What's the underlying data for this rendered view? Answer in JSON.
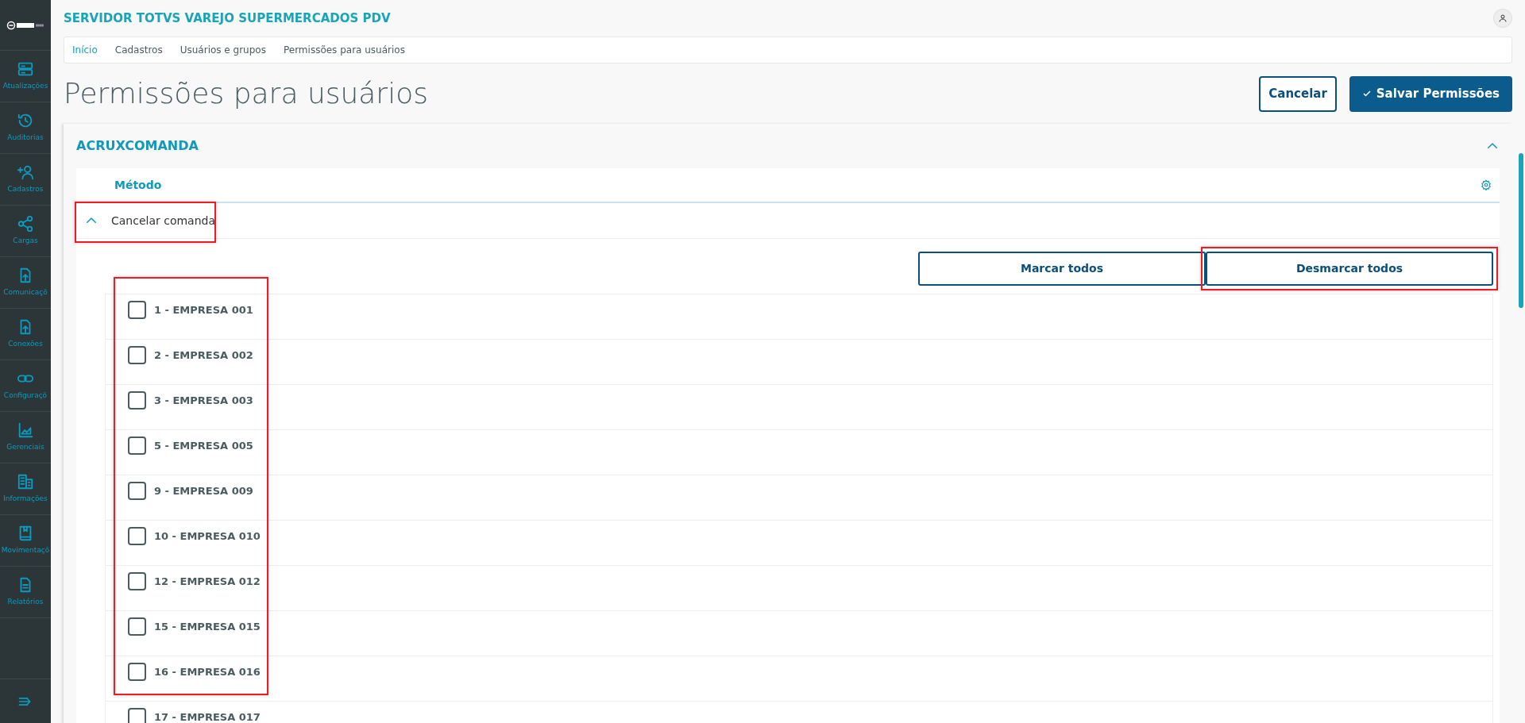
{
  "app": {
    "title": "SERVIDOR TOTVS VAREJO SUPERMERCADOS PDV"
  },
  "sidebar": {
    "items": [
      {
        "label": "Atualizações"
      },
      {
        "label": "Auditorias"
      },
      {
        "label": "Cadastros"
      },
      {
        "label": "Cargas"
      },
      {
        "label": "Comunicaçõ"
      },
      {
        "label": "Conexões"
      },
      {
        "label": "Configuraçõ"
      },
      {
        "label": "Gerenciais"
      },
      {
        "label": "Informações"
      },
      {
        "label": "Movimentaçõ"
      },
      {
        "label": "Relatórios"
      }
    ]
  },
  "breadcrumb": [
    {
      "label": "Início",
      "link": true
    },
    {
      "label": "Cadastros",
      "link": false
    },
    {
      "label": "Usuários e grupos",
      "link": false
    },
    {
      "label": "Permissões para usuários",
      "link": false
    }
  ],
  "page_title": "Permissões para usuários",
  "actions": [
    {
      "label": "Cancelar",
      "kind": "outline"
    },
    {
      "label": "Salvar Permissões",
      "kind": "primary"
    }
  ],
  "panel": {
    "title": "ACRUXCOMANDA",
    "expanded": true,
    "table": {
      "column": "Método",
      "rows": [
        {
          "label": "Cancelar comanda",
          "expanded": true,
          "highlighted": true
        }
      ]
    },
    "bulk_buttons": [
      {
        "label": "Marcar todos",
        "highlighted": false
      },
      {
        "label": "Desmarcar todos",
        "highlighted": true
      }
    ],
    "companies_highlighted": true,
    "companies": [
      {
        "label": "1 - EMPRESA 001",
        "checked": false
      },
      {
        "label": "2 - EMPRESA 002",
        "checked": false
      },
      {
        "label": "3 - EMPRESA 003",
        "checked": false
      },
      {
        "label": "5 - EMPRESA 005",
        "checked": false
      },
      {
        "label": "9 - EMPRESA 009",
        "checked": false
      },
      {
        "label": "10 - EMPRESA 010",
        "checked": false
      },
      {
        "label": "12 - EMPRESA 012",
        "checked": false
      },
      {
        "label": "15 - EMPRESA 015",
        "checked": false
      },
      {
        "label": "16 - EMPRESA 016",
        "checked": false
      },
      {
        "label": "17 - EMPRESA 017",
        "checked": false
      }
    ]
  }
}
